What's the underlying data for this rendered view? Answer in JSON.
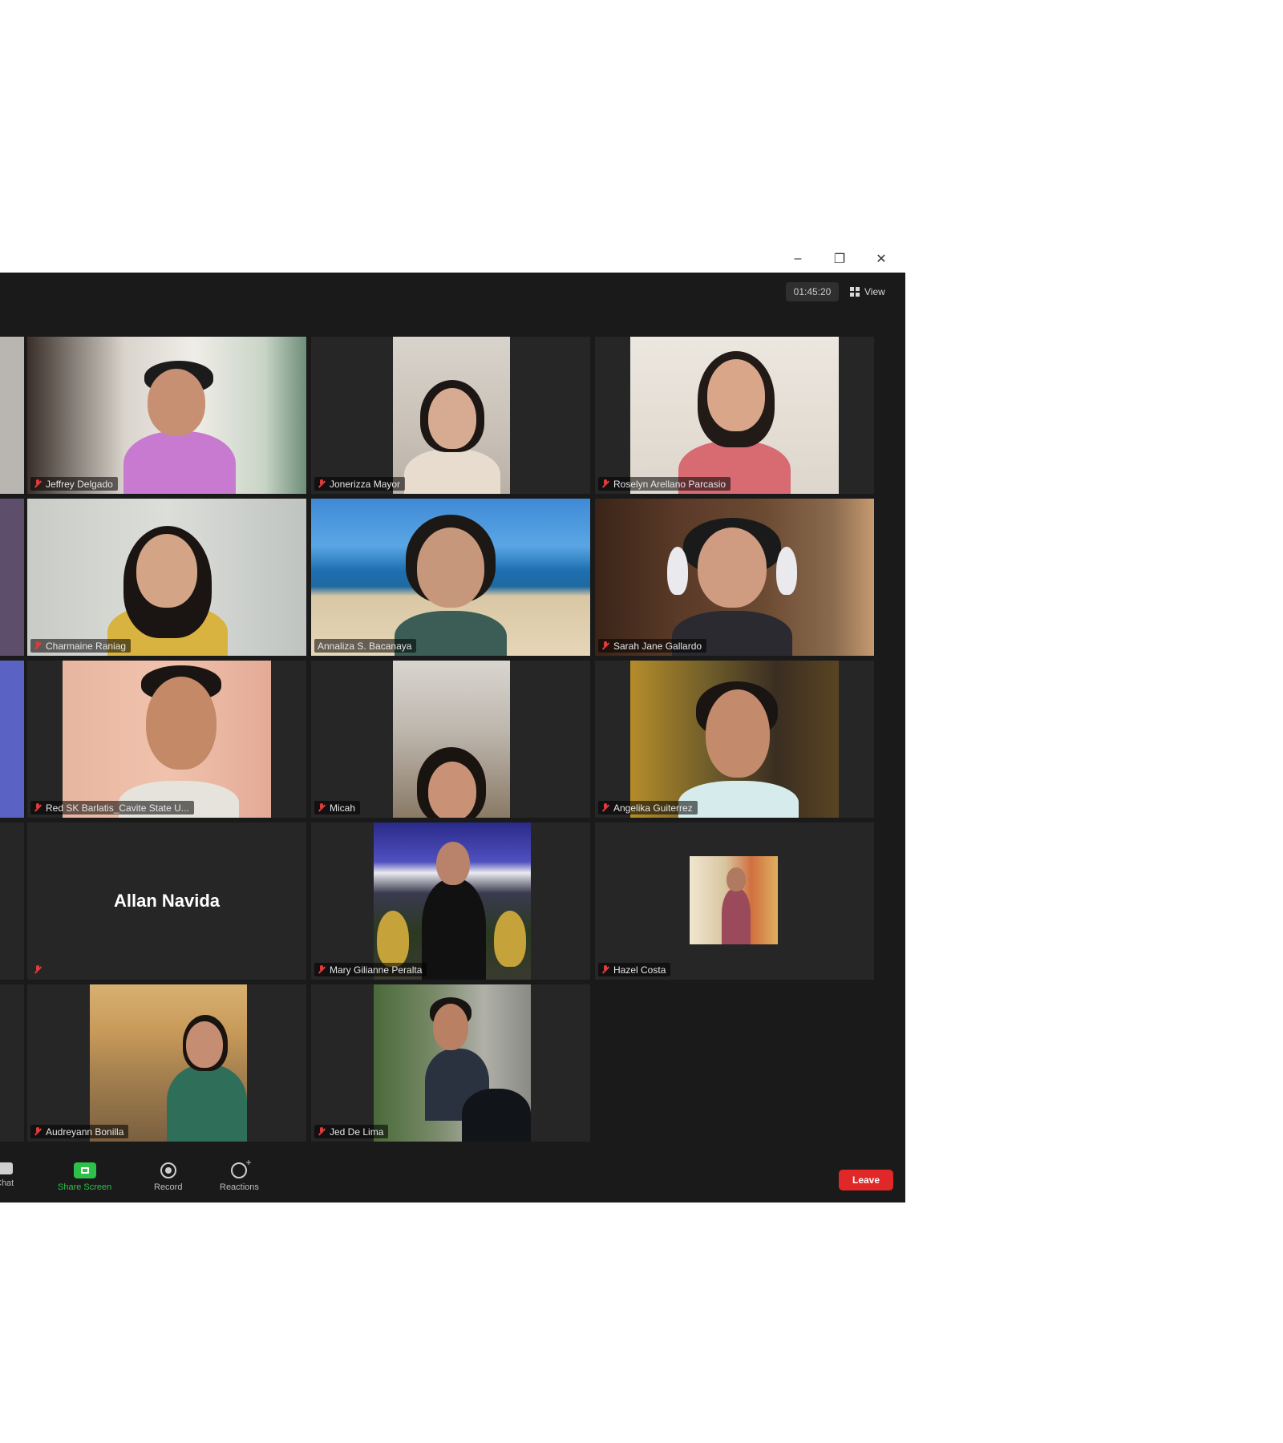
{
  "window": {
    "minimize": "–",
    "restore": "❐",
    "close": "✕"
  },
  "topbar": {
    "timer": "01:45:20",
    "view_label": "View"
  },
  "participants": [
    {
      "name": "Jeffrey Delgado"
    },
    {
      "name": "Jonerizza Mayor"
    },
    {
      "name": "Roselyn Arellano Parcasio"
    },
    {
      "name": "Charmaine Raniag"
    },
    {
      "name": "Annaliza S. Bacanaya"
    },
    {
      "name": "Sarah Jane Gallardo"
    },
    {
      "name": "Red SK Barlatis_Cavite State U..."
    },
    {
      "name": "Micah"
    },
    {
      "name": "Angelika Guiterrez"
    },
    {
      "name": "Allan Navida"
    },
    {
      "name": "Mary Gilianne Peralta"
    },
    {
      "name": "Hazel Costa"
    },
    {
      "name": "Audreyann Bonilla"
    },
    {
      "name": "Jed De Lima"
    }
  ],
  "toolbar": {
    "chat": "Chat",
    "share_screen": "Share Screen",
    "record": "Record",
    "reactions": "Reactions",
    "leave": "Leave"
  },
  "colors": {
    "meeting_bg": "#1a1a1a",
    "tile_bg": "#262626",
    "share_green": "#2ec14a",
    "leave_red": "#e02828",
    "muted_red": "#e03b3b"
  }
}
